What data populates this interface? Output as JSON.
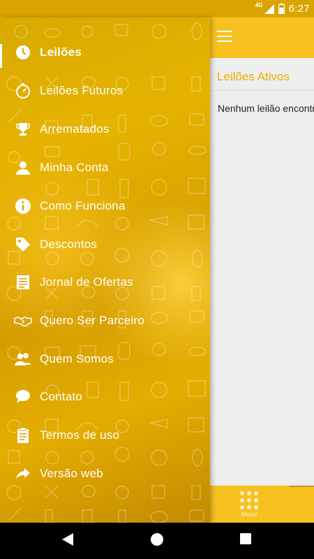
{
  "status_bar": {
    "network": "4G",
    "time": "6:27"
  },
  "app_bar": {
    "menu_icon": "hamburger-icon"
  },
  "main": {
    "section_title": "Leilões Ativos",
    "empty_message": "Nenhum leilão encontrado"
  },
  "bottom_tab": {
    "label": "Menu",
    "icon": "grid-dots-icon"
  },
  "drawer": {
    "items": [
      {
        "label": "Leilões",
        "icon": "clock-icon",
        "active": true
      },
      {
        "label": "Leilões Futuros",
        "icon": "timer-icon"
      },
      {
        "label": "Arrematados",
        "icon": "trophy-icon"
      },
      {
        "label": "Minha Conta",
        "icon": "person-icon"
      },
      {
        "label": "Como Funciona",
        "icon": "info-icon"
      },
      {
        "label": "Descontos",
        "icon": "tag-icon"
      },
      {
        "label": "Jornal de Ofertas",
        "icon": "newspaper-icon"
      },
      {
        "label": "Quero Ser Parceiro",
        "icon": "handshake-icon"
      },
      {
        "label": "Quem Somos",
        "icon": "people-icon"
      },
      {
        "label": "Contato",
        "icon": "chat-bubble-icon"
      },
      {
        "label": "Termos de uso",
        "icon": "clipboard-icon"
      },
      {
        "label": "Versão web",
        "icon": "share-arrow-icon"
      }
    ]
  },
  "colors": {
    "accent": "#f7c120",
    "drawer": "#e0aa00",
    "title": "#e8b200"
  }
}
